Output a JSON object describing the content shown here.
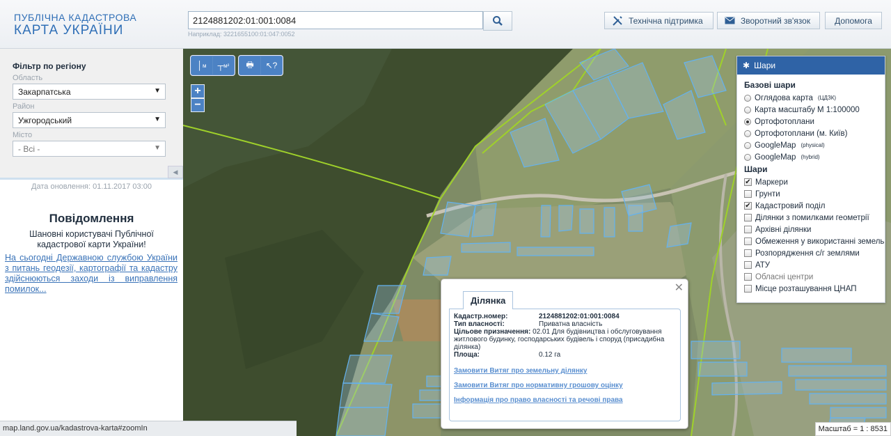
{
  "header": {
    "logo_line1": "ПУБЛІЧНА КАДАСТРОВА",
    "logo_line2": "КАРТА УКРАЇНИ",
    "search_value": "2124881202:01:001:0084",
    "search_hint": "Наприклад: 3221655100:01:047:0052",
    "support_label": "Технічна підтримка",
    "feedback_label": "Зворотний зв'язок",
    "help_label": "Допомога"
  },
  "sidebar": {
    "filter_title": "Фільтр по регіону",
    "oblast_label": "Область",
    "oblast_value": "Закарпатська",
    "raion_label": "Район",
    "raion_value": "Ужгородський",
    "city_label": "Місто",
    "city_value": "- Всі -",
    "update_date": "Дата оновлення: 01.11.2017 03:00",
    "notice_title": "Повідомлення",
    "notice_text": "Шановні користувачі Публічної кадастрової карти України!",
    "notice_link": "На сьогодні Державною службою України з питань геодезії, картографії та кадастру здійснюються заходи із виправлення помилок..."
  },
  "toolbar": {
    "measure_label": "м",
    "measure_area_label": "м²"
  },
  "layers": {
    "title": "Шари",
    "base_title": "Базові шари",
    "base": [
      {
        "label": "Оглядова карта",
        "sup": "(ЦДЗК)",
        "checked": false
      },
      {
        "label": "Карта масштабу М 1:100000",
        "sup": "",
        "checked": false
      },
      {
        "label": "Ортофотоплани",
        "sup": "",
        "checked": true
      },
      {
        "label": "Ортофотоплани (м. Київ)",
        "sup": "",
        "checked": false
      },
      {
        "label": "GoogleMap",
        "sup": "(physical)",
        "checked": false
      },
      {
        "label": "GoogleMap",
        "sup": "(hybrid)",
        "checked": false
      }
    ],
    "overlay_title": "Шари",
    "overlays": [
      {
        "label": "Маркери",
        "checked": true,
        "disabled": false
      },
      {
        "label": "Грунти",
        "checked": false,
        "disabled": false
      },
      {
        "label": "Кадастровий поділ",
        "checked": true,
        "disabled": false
      },
      {
        "label": "Ділянки з помилками геометрії",
        "checked": false,
        "disabled": false
      },
      {
        "label": "Архівні ділянки",
        "checked": false,
        "disabled": false
      },
      {
        "label": "Обмеження у використанні земель",
        "checked": false,
        "disabled": false
      },
      {
        "label": "Розпорядження с/г землями",
        "checked": false,
        "disabled": false
      },
      {
        "label": "АТУ",
        "checked": false,
        "disabled": false
      },
      {
        "label": "Обласні центри",
        "checked": false,
        "disabled": true
      },
      {
        "label": "Місце розташування ЦНАП",
        "checked": false,
        "disabled": false
      }
    ]
  },
  "popup": {
    "tab": "Ділянка",
    "cadastral_key": "Кадастр.номер:",
    "cadastral_value": "2124881202:01:001:0084",
    "ownership_key": "Тип власності:",
    "ownership_value": "Приватна власність",
    "purpose_key": "Цільове призначення:",
    "purpose_value": "02.01 Для будівництва і обслуговування житлового будинку, господарських будівель і споруд (присадибна ділянка)",
    "area_key": "Площа:",
    "area_value": "0.12 га",
    "link1": "Замовити Витяг про земельну ділянку",
    "link2": "Замовити Витяг про нормативну грошову оцінку",
    "link3": "Інформація про право власності та речові права"
  },
  "scale": "Масштаб = 1 : 8531",
  "status_url": "map.land.gov.ua/kadastrova-karta#zoomIn"
}
